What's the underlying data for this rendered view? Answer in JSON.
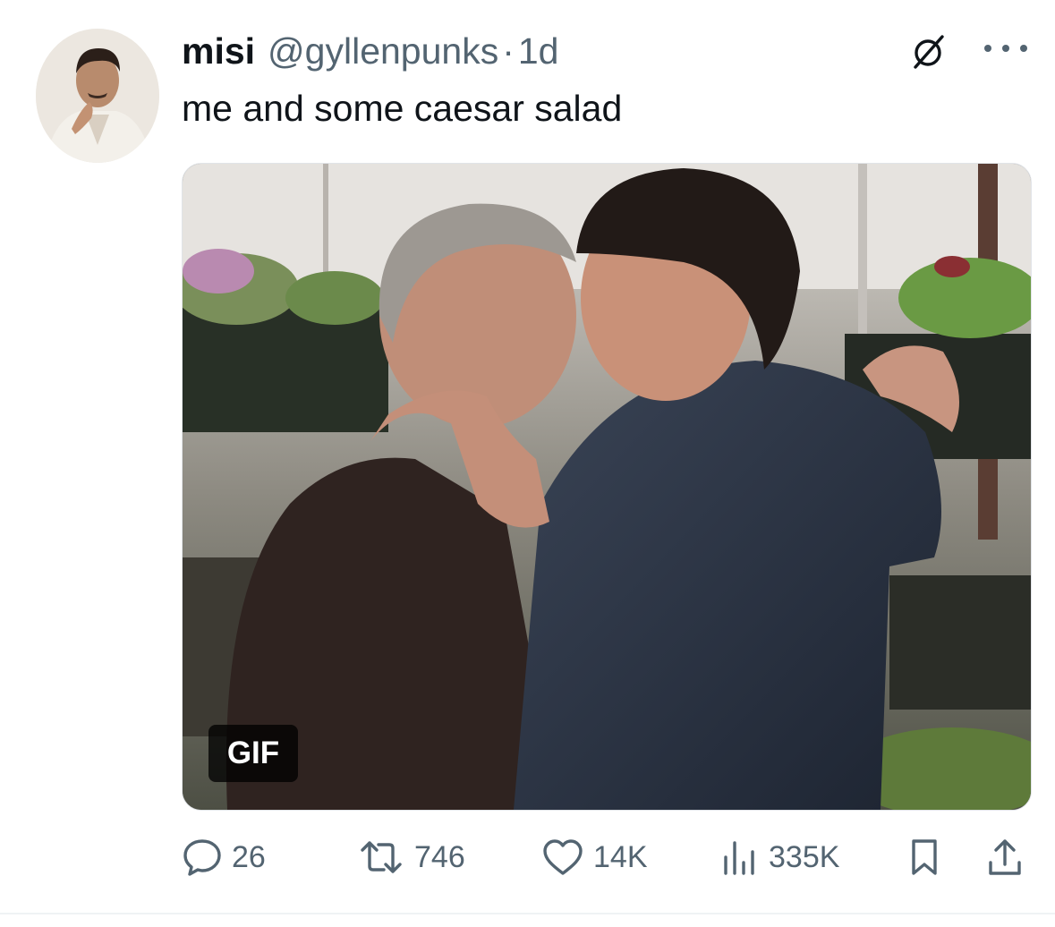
{
  "tweet": {
    "author_name": "misi",
    "author_handle": "@gyllenpunks",
    "separator": "·",
    "timestamp": "1d",
    "text": "me and some caesar salad",
    "media_badge": "GIF"
  },
  "actions": {
    "replies": "26",
    "retweets": "746",
    "likes": "14K",
    "views": "335K"
  },
  "icons": {
    "reply": "speech-bubble-icon",
    "retweet": "retweet-arrows-icon",
    "like": "heart-icon",
    "views": "bar-chart-icon",
    "bookmark": "bookmark-icon",
    "share": "share-upload-icon",
    "grok": "slashed-circle-icon",
    "more": "more-dots-icon"
  },
  "colors": {
    "text_primary": "#0f1419",
    "text_secondary": "#536471",
    "badge_bg": "#000000"
  }
}
